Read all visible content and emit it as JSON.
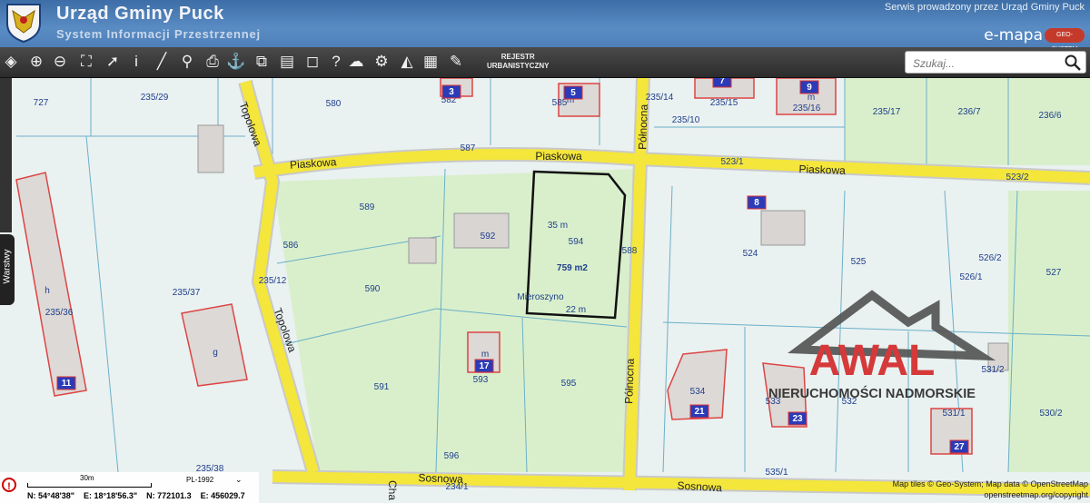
{
  "header": {
    "title": "Urząd Gminy Puck",
    "subtitle": "System Informacji Przestrzennej",
    "provider": "Serwis prowadzony przez Urząd Gminy Puck",
    "emapa": "e-mapa",
    "emapa_logo": "GEO-SYSTEM",
    "crest_icon": "coat-of-arms-icon"
  },
  "toolbar": {
    "tools": [
      {
        "name": "layers-icon",
        "glyph": "◈"
      },
      {
        "name": "zoom-in-icon",
        "glyph": "⊕"
      },
      {
        "name": "zoom-out-icon",
        "glyph": "⊖"
      },
      {
        "name": "zoom-extent-icon",
        "glyph": "⛶"
      },
      {
        "name": "select-arrow-icon",
        "glyph": "➚"
      },
      {
        "name": "info-icon",
        "glyph": "i"
      },
      {
        "name": "measure-ruler-icon",
        "glyph": "╱"
      },
      {
        "name": "link-icon",
        "glyph": "⚲"
      },
      {
        "name": "print-icon",
        "glyph": "⎙"
      },
      {
        "name": "anchor-icon",
        "glyph": "⚓"
      },
      {
        "name": "export-icon",
        "glyph": "⧉"
      },
      {
        "name": "layout-icon",
        "glyph": "▤"
      },
      {
        "name": "comment-icon",
        "glyph": "◻"
      },
      {
        "name": "help-icon",
        "glyph": "?"
      },
      {
        "name": "cloud-upload-icon",
        "glyph": "☁"
      },
      {
        "name": "settings-icon",
        "glyph": "⚙"
      },
      {
        "name": "terrain-icon",
        "glyph": "◭"
      },
      {
        "name": "color-grid-icon",
        "glyph": "▦"
      },
      {
        "name": "registry-icon",
        "glyph": "✎"
      }
    ],
    "rejestr_line1": "REJESTR",
    "rejestr_line2": "URBANISTYCZNY",
    "search_placeholder": "Szukaj..."
  },
  "sidebar": {
    "warstwy": "Warstwy"
  },
  "map": {
    "streets": [
      "Piaskowa",
      "Piaskowa",
      "Piaskowa",
      "Topolowa",
      "Topolowa",
      "Północna",
      "Północna",
      "Sosnowa",
      "Sosnowa",
      "Cha"
    ],
    "parcels": [
      "727",
      "235/29",
      "580",
      "582",
      "585",
      "235/14",
      "235/10",
      "235/15",
      "235/16",
      "235/17",
      "236/7",
      "236/6",
      "587",
      "523/1",
      "523/2",
      "589",
      "586",
      "592",
      "594",
      "588",
      "524",
      "525",
      "526/2",
      "527",
      "526/1",
      "235/12",
      "235/37",
      "235/36",
      "590",
      "591",
      "593",
      "595",
      "534",
      "533",
      "532",
      "531/2",
      "531/1",
      "530/2",
      "235/38",
      "596",
      "234/1",
      "535/1",
      "h",
      "g",
      "m",
      "m",
      "m"
    ],
    "house_numbers": [
      "3",
      "5",
      "7",
      "9",
      "8",
      "11",
      "17",
      "21",
      "23",
      "27"
    ],
    "locality": "Mieroszyno",
    "plot": {
      "area": "759 m2",
      "side_a": "35 m",
      "side_b": "22 m"
    },
    "watermark": {
      "brand": "AWAL",
      "tagline": "NIERUCHOMOŚCI NADMORSKIE",
      "accent": "#d42a2a"
    }
  },
  "scale": {
    "label": "30m",
    "crs": "PL-1992",
    "coords": [
      "N: 54°48'38\"",
      "E: 18°18'56.3\"",
      "N: 772101.3",
      "E: 456029.7"
    ]
  },
  "attribution": {
    "line1": "Map tiles © Geo-System; Map data © OpenStreetMap",
    "line2": "openstreetmap.org/copyright"
  }
}
